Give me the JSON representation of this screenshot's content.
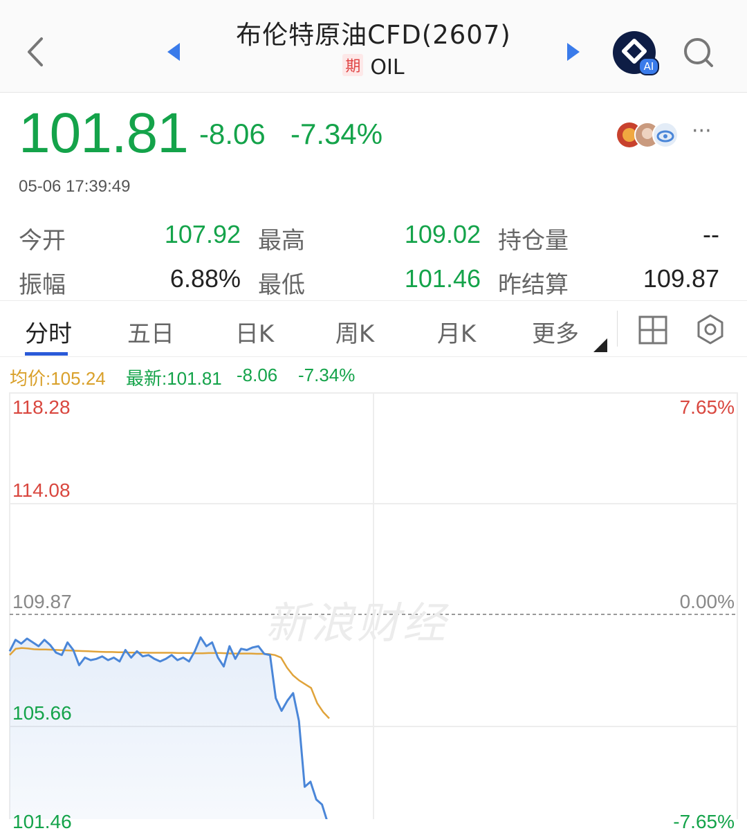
{
  "header": {
    "title": "布伦特原油CFD(2607)",
    "badge": "期",
    "code": "OIL",
    "ai_label": "AI"
  },
  "quote": {
    "price": "101.81",
    "change": "-8.06",
    "change_pct": "-7.34%",
    "timestamp": "05-06 17:39:49",
    "more": "···"
  },
  "stats": {
    "open_label": "今开",
    "open": "107.92",
    "high_label": "最高",
    "high": "109.02",
    "oi_label": "持仓量",
    "oi": "--",
    "amp_label": "振幅",
    "amp": "6.88%",
    "low_label": "最低",
    "low": "101.46",
    "prev_label": "昨结算",
    "prev": "109.87"
  },
  "tabs": [
    "分时",
    "五日",
    "日K",
    "周K",
    "月K",
    "更多"
  ],
  "chart": {
    "avg_label": "均价:105.24",
    "latest_label": "最新:101.81",
    "latest_change": "-8.06",
    "latest_pct": "-7.34%",
    "y_left": [
      "118.28",
      "114.08",
      "109.87",
      "105.66",
      "101.46"
    ],
    "y_right": [
      "7.65%",
      "0.00%",
      "-7.65%"
    ],
    "watermark": "新浪财经",
    "colors": {
      "price_line": "#4a86d8",
      "avg_line": "#e0a33a",
      "up": "#d9473f",
      "down": "#14a34a"
    }
  },
  "chart_data": {
    "type": "line",
    "ylim": [
      101.46,
      118.28
    ],
    "reference": 109.87,
    "series": [
      {
        "name": "最新",
        "values": [
          108.25,
          108.7,
          108.55,
          108.75,
          108.6,
          108.45,
          108.7,
          108.5,
          108.2,
          108.1,
          108.6,
          108.3,
          107.7,
          108.0,
          107.9,
          107.95,
          108.05,
          107.9,
          108.0,
          107.85,
          108.3,
          108.0,
          108.25,
          108.05,
          108.1,
          107.95,
          107.85,
          107.95,
          108.1,
          107.9,
          108.0,
          107.85,
          108.25,
          108.8,
          108.45,
          108.6,
          108.0,
          107.65,
          108.45,
          107.95,
          108.35,
          108.3,
          108.4,
          108.45,
          108.15,
          108.1,
          106.4,
          105.9,
          106.3,
          106.6,
          105.5,
          102.9,
          103.1,
          102.4,
          102.2,
          101.46
        ]
      },
      {
        "name": "均价",
        "values": [
          108.1,
          108.35,
          108.38,
          108.36,
          108.33,
          108.32,
          108.32,
          108.31,
          108.3,
          108.29,
          108.28,
          108.27,
          108.26,
          108.25,
          108.24,
          108.23,
          108.22,
          108.22,
          108.21,
          108.21,
          108.2,
          108.2,
          108.2,
          108.19,
          108.19,
          108.19,
          108.19,
          108.19,
          108.18,
          108.18,
          108.18,
          108.17,
          108.17,
          108.18,
          108.18,
          108.18,
          108.17,
          108.16,
          108.16,
          108.16,
          108.16,
          108.15,
          108.15,
          108.14,
          108.1,
          108.0,
          107.6,
          107.3,
          107.1,
          106.95,
          106.8,
          106.2,
          105.85,
          105.6
        ]
      }
    ]
  }
}
